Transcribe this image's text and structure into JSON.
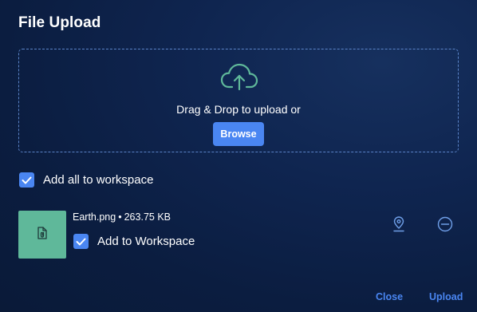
{
  "dialog": {
    "title": "File Upload",
    "accent_color": "#4a86f2",
    "background_color": "#0f2550"
  },
  "dropzone": {
    "icon": "cloud-upload-icon",
    "icon_color": "#5fb89a",
    "text": "Drag & Drop to upload or",
    "browse_label": "Browse"
  },
  "add_all": {
    "checked": true,
    "label": "Add all to workspace"
  },
  "files": [
    {
      "name": "Earth.png",
      "separator": "•",
      "size": "263.75 KB",
      "thumb_icon": "paperclip-file-icon",
      "thumb_color": "#5fb89a",
      "add_to_workspace_checked": true,
      "add_to_workspace_label": "Add to Workspace",
      "actions": [
        "location-pin-icon",
        "remove-circle-icon"
      ]
    }
  ],
  "footer": {
    "close_label": "Close",
    "upload_label": "Upload"
  }
}
